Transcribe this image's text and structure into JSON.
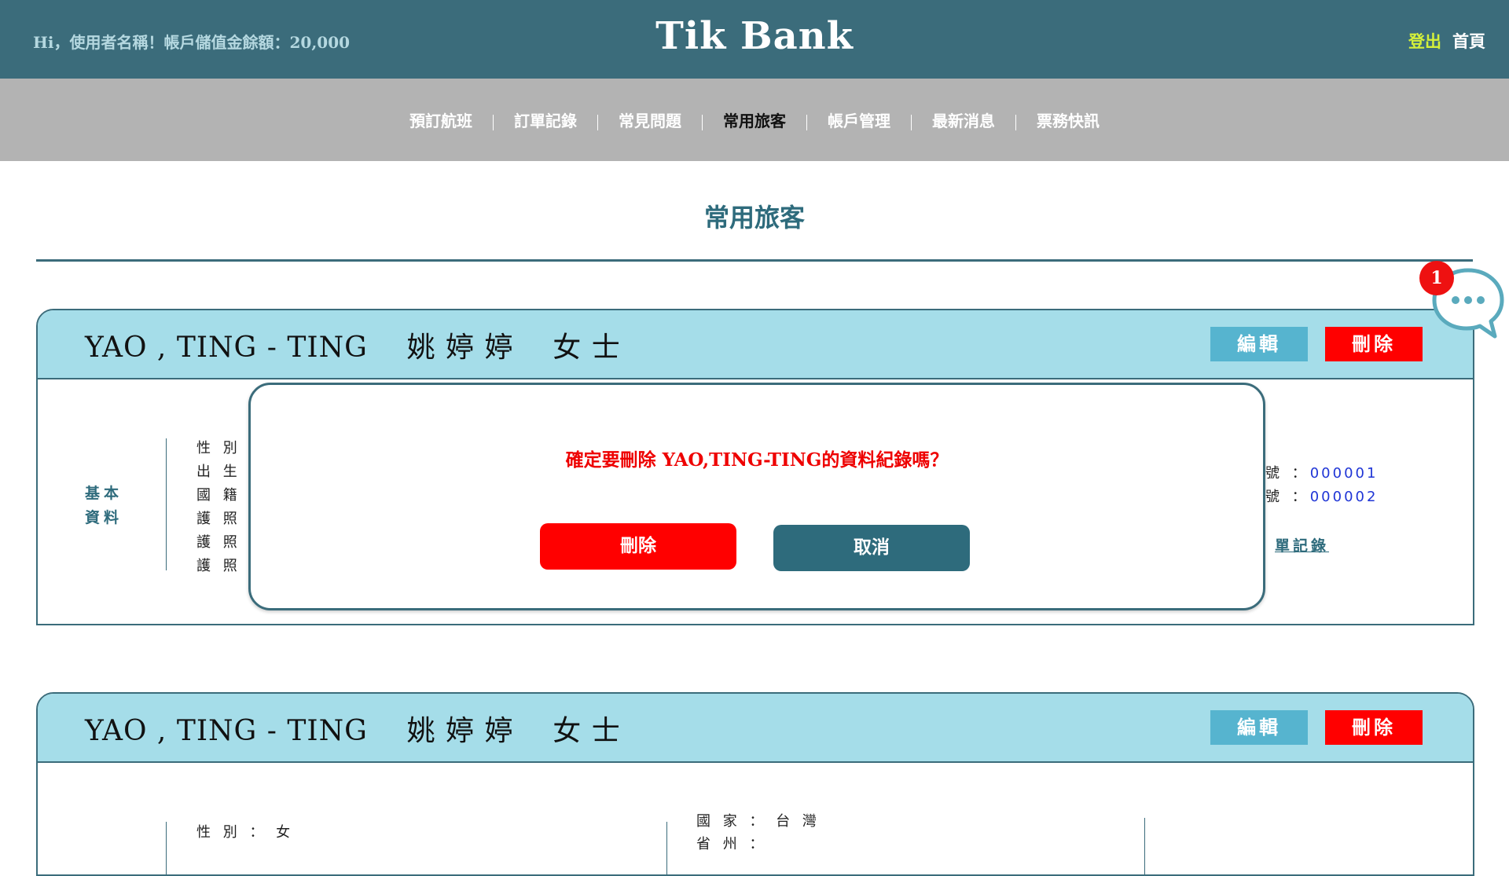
{
  "header": {
    "greeting": "Hi，使用者名稱！帳戶儲值金餘額：20,000",
    "brand": "Tik Bank",
    "logout": "登出",
    "home": "首頁"
  },
  "nav": {
    "items": [
      {
        "label": "預訂航班",
        "active": false
      },
      {
        "label": "訂單記錄",
        "active": false
      },
      {
        "label": "常見問題",
        "active": false
      },
      {
        "label": "常用旅客",
        "active": true
      },
      {
        "label": "帳戶管理",
        "active": false
      },
      {
        "label": "最新消息",
        "active": false
      },
      {
        "label": "票務快訊",
        "active": false
      }
    ]
  },
  "page": {
    "title": "常用旅客"
  },
  "cards": [
    {
      "name": "YAO , TING - TING    姚 婷 婷    女 士",
      "edit_label": "編輯",
      "delete_label": "刪除",
      "section_label_1": "基本",
      "section_label_2": "資料",
      "fields": [
        "性 別 ：",
        "出 生 日",
        "國 籍 ：",
        "護 照 號",
        "護 照 國",
        "護 照 有"
      ],
      "right_fields": [
        {
          "label": "號 ：",
          "value": "000001"
        },
        {
          "label": "號 ：",
          "value": "000002"
        }
      ],
      "record_link": "單記錄"
    },
    {
      "name": "YAO , TING - TING    姚 婷 婷    女 士",
      "edit_label": "編輯",
      "delete_label": "刪除",
      "gender_field": "性 別 ： 女",
      "country_field": "國 家 ： 台 灣",
      "state_field": "省 州 ："
    }
  ],
  "modal": {
    "message": "確定要刪除 YAO,TING-TING的資料紀錄嗎？",
    "confirm_label": "刪除",
    "cancel_label": "取消"
  },
  "chat": {
    "badge_count": "1"
  },
  "colors": {
    "header_bg": "#3b6c7b",
    "nav_bg": "#b3b3b3",
    "card_head_bg": "#a5dde9",
    "danger": "#ff0000",
    "edit": "#56b4cf",
    "accent_text": "#2e6b7c",
    "link_blue": "#1f35d6"
  }
}
